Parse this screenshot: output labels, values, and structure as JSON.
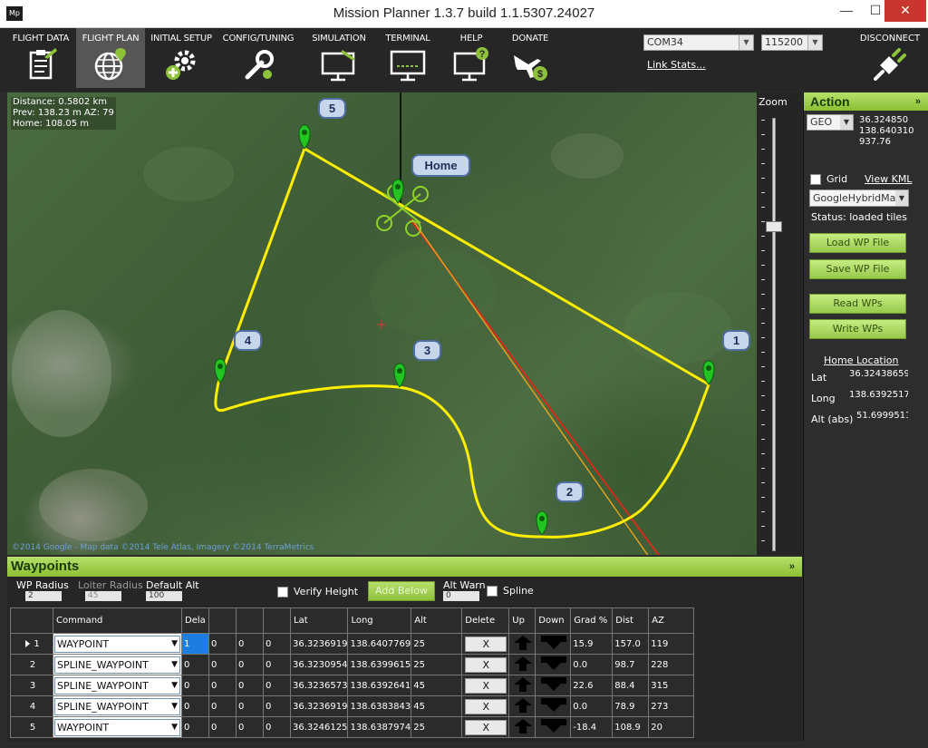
{
  "window": {
    "title": "Mission Planner 1.3.7 build 1.1.5307.24027",
    "app_icon": "Mp",
    "min_glyph": "—",
    "max_glyph": "☐",
    "close_glyph": "✕"
  },
  "toolbar": {
    "buttons": [
      {
        "label": "FLIGHT DATA",
        "icon": "clipboard-icon"
      },
      {
        "label": "FLIGHT PLAN",
        "icon": "globe-pin-icon"
      },
      {
        "label": "INITIAL SETUP",
        "icon": "gear-plus-icon"
      },
      {
        "label": "CONFIG/TUNING",
        "icon": "wrench-gear-icon"
      },
      {
        "label": "SIMULATION",
        "icon": "monitor-plane-icon"
      },
      {
        "label": "TERMINAL",
        "icon": "terminal-monitor-icon"
      },
      {
        "label": "HELP",
        "icon": "help-monitor-icon"
      },
      {
        "label": "DONATE",
        "icon": "plane-dollar-icon"
      }
    ],
    "port": "COM34",
    "baud": "115200",
    "link_stats": "Link Stats...",
    "disconnect": "DISCONNECT"
  },
  "map": {
    "info": [
      "Distance: 0.5802 km",
      "Prev: 138.23 m AZ: 79",
      "Home: 108.05 m"
    ],
    "copyright": "©2014 Google - Map data ©2014 Tele Atlas, Imagery ©2014 TerraMetrics",
    "home_label": "Home",
    "markers": [
      "1",
      "2",
      "3",
      "4",
      "5"
    ]
  },
  "zoom": {
    "label": "Zoom"
  },
  "action": {
    "title": "Action",
    "chevron": "»",
    "coord_mode": "GEO",
    "coords": [
      "36.324850",
      "138.640310",
      "937.76"
    ],
    "grid_label": "Grid",
    "view_kml": "View KML",
    "map_type": "GoogleHybridMap",
    "status": "Status: loaded tiles",
    "load_wp": "Load WP File",
    "save_wp": "Save WP File",
    "read_wps": "Read WPs",
    "write_wps": "Write WPs",
    "home_location": "Home Location",
    "lat_label": "Lat",
    "lat_value": "36.32438659E",
    "long_label": "Long",
    "long_value": "138.6392517(",
    "alt_label": "Alt (abs)",
    "alt_value": "51.6999511"
  },
  "waypoints": {
    "title": "Waypoints",
    "chevron": "»",
    "wp_radius_label": "WP Radius",
    "wp_radius": "2",
    "loiter_radius_label": "Loiter Radius",
    "loiter_radius": "45",
    "default_alt_label": "Default Alt",
    "default_alt": "100",
    "verify_height": "Verify Height",
    "add_below": "Add Below",
    "alt_warn_label": "Alt Warn",
    "alt_warn": "0",
    "spline": "Spline",
    "columns": [
      "",
      "Command",
      "Dela",
      "",
      "",
      "",
      "Lat",
      "Long",
      "Alt",
      "Delete",
      "Up",
      "Down",
      "Grad %",
      "Dist",
      "AZ"
    ],
    "delete_glyph": "X",
    "rows": [
      {
        "n": "1",
        "cmd": "WAYPOINT",
        "p1": "1",
        "p2": "0",
        "p3": "0",
        "p4": "0",
        "lat": "36.3236919",
        "lng": "138.6407769",
        "alt": "25",
        "grad": "15.9",
        "dist": "157.0",
        "az": "119"
      },
      {
        "n": "2",
        "cmd": "SPLINE_WAYPOINT",
        "p1": "0",
        "p2": "0",
        "p3": "0",
        "p4": "0",
        "lat": "36.3230954",
        "lng": "138.6399615",
        "alt": "25",
        "grad": "0.0",
        "dist": "98.7",
        "az": "228"
      },
      {
        "n": "3",
        "cmd": "SPLINE_WAYPOINT",
        "p1": "0",
        "p2": "0",
        "p3": "0",
        "p4": "0",
        "lat": "36.3236573",
        "lng": "138.6392641",
        "alt": "45",
        "grad": "22.6",
        "dist": "88.4",
        "az": "315"
      },
      {
        "n": "4",
        "cmd": "SPLINE_WAYPOINT",
        "p1": "0",
        "p2": "0",
        "p3": "0",
        "p4": "0",
        "lat": "36.3236919",
        "lng": "138.6383843",
        "alt": "45",
        "grad": "0.0",
        "dist": "78.9",
        "az": "273"
      },
      {
        "n": "5",
        "cmd": "WAYPOINT",
        "p1": "0",
        "p2": "0",
        "p3": "0",
        "p4": "0",
        "lat": "36.3246125",
        "lng": "138.6387974",
        "alt": "25",
        "grad": "-18.4",
        "dist": "108.9",
        "az": "20"
      }
    ]
  },
  "colors": {
    "accent_green": "#9ccf45",
    "route_yellow": "#ffee00",
    "marker_green": "#22c422",
    "selected_blue": "#1e7de0"
  }
}
